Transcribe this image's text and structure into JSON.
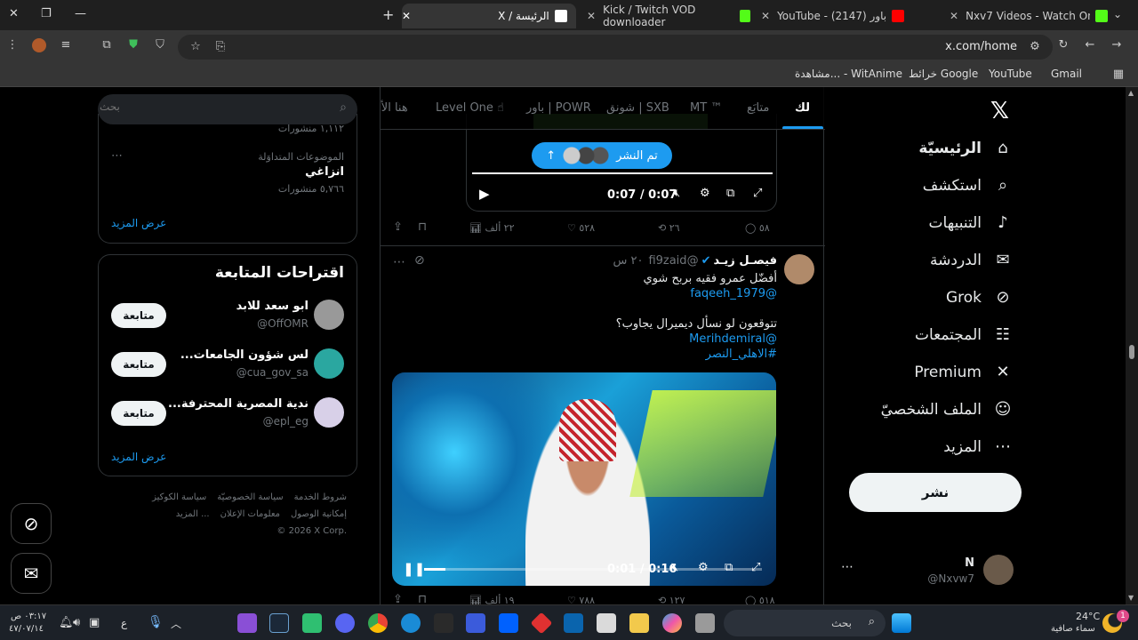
{
  "tabs": [
    {
      "title": "Nxv7 Videos - Watch On-Dema",
      "color": "#53fc18"
    },
    {
      "title": "YouTube - (2147) باور",
      "color": "#ff0000"
    },
    {
      "title": "Kick / Twitch VOD downloader",
      "color": "#53fc18"
    },
    {
      "title": "X / الرئيسة",
      "color": "#ffffff"
    }
  ],
  "address": {
    "url": "x.com/home"
  },
  "bookmarks": [
    {
      "label": "Gmail",
      "color": "#ea4335"
    },
    {
      "label": "YouTube",
      "color": "#ff0000"
    },
    {
      "label": "خرائط Google",
      "color": "#34a853"
    },
    {
      "label": "مشاهدة... - WitAnime",
      "color": "#2ec4b6"
    }
  ],
  "nav": [
    {
      "label": "الرئيسيّة",
      "icon": "house-icon",
      "glyph": "⌂",
      "active": true
    },
    {
      "label": "استكشف",
      "icon": "search-icon",
      "glyph": "⌕"
    },
    {
      "label": "التنبيهات",
      "icon": "bell-icon",
      "glyph": "🔔"
    },
    {
      "label": "الدردشة",
      "icon": "mail-icon",
      "glyph": "✉"
    },
    {
      "label": "Grok",
      "icon": "grok-icon",
      "glyph": "⊘"
    },
    {
      "label": "المجتمعات",
      "icon": "people-icon",
      "glyph": "☷"
    },
    {
      "label": "Premium",
      "icon": "x-icon",
      "glyph": "𝕏"
    },
    {
      "label": "الملف الشخصيّ",
      "icon": "profile-icon",
      "glyph": "☺"
    },
    {
      "label": "المزيد",
      "icon": "more-icon",
      "glyph": "⋯"
    }
  ],
  "post_button": "نشر",
  "account": {
    "name": "N",
    "handle": "@Nxvw7"
  },
  "timeline_tabs": [
    "لك",
    "متابَع",
    "MT ™",
    "شونق | SXB",
    "باور | POWR",
    "Level One ☝",
    "هنا الأه"
  ],
  "video1": {
    "time": "0:07 / 0:07",
    "posted_pill": "تم النشر"
  },
  "tweet1_actions": {
    "replies": "٥٨",
    "retweets": "٢٦",
    "likes": "٥٢٨",
    "views": "٢٢ ألف"
  },
  "tweet2": {
    "name": "فيصـل زيـد",
    "handle": "@fi9zaid",
    "time": "٢٠ س",
    "line1": "أفضّل عمرو فقيه بربح شوي",
    "mention1": "@faqeeh_1979",
    "line2": "تتوقعون لو نسأل ديميرال يجاوب؟",
    "mention2": "@Merihdemiral",
    "hashtag": "#الاهلي_النصر",
    "video_time": "0:01 / 0:16"
  },
  "tweet2_actions": {
    "replies": "٥١٨",
    "retweets": "١٢٧",
    "likes": "٧٨٨",
    "views": "١٩ ألف"
  },
  "search": {
    "placeholder": "بحث"
  },
  "trends": {
    "count_top": "١,١١٢ منشورات",
    "category": "الموضوعات المتداوَلة",
    "title": "انزاغي",
    "count": "٥,٧٦٦ منشورات",
    "show_more": "عرض المزيد"
  },
  "follow": {
    "title": "اقتراحات المتابعة",
    "follow_label": "متابعة",
    "show_more": "عرض المزيد",
    "users": [
      {
        "name": "ابو سعد للابد",
        "handle": "@OffOMR"
      },
      {
        "name": "...لس شؤون الجامعات",
        "handle": "@cua_gov_sa"
      },
      {
        "name": "...ندية المصرية المحترفة",
        "handle": "@epl_eg"
      }
    ]
  },
  "footer": {
    "links": [
      "شروط الخدمة",
      "سياسة الخصوصيّة",
      "سياسة الكوكيز",
      "إمكانية الوصول",
      "معلومات الإعلان",
      "... المزيد"
    ],
    "copyright": "© 2026 X Corp."
  },
  "taskbar": {
    "search": "بحث",
    "weather_temp": "24°C",
    "weather_desc": "سماء صافية",
    "time": "٠٣:١٧ ص",
    "date": "٤٧/٠٧/١٤",
    "lang": "ع",
    "notif": "1"
  }
}
